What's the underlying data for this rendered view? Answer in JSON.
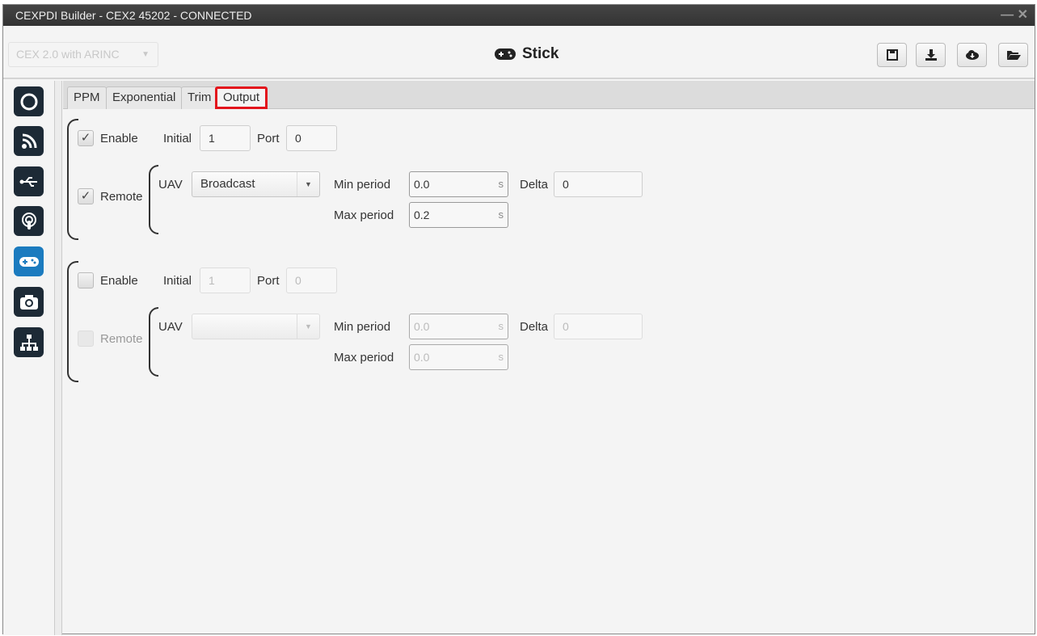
{
  "window": {
    "title": "CEXPDI Builder - CEX2 45202 - CONNECTED",
    "controls": "— ✕"
  },
  "header": {
    "device_select": "CEX 2.0 with ARINC",
    "page_title": "Stick"
  },
  "toolbar": [
    "save-icon",
    "download-icon",
    "cloud-download-icon",
    "folder-open-icon"
  ],
  "sidebar": {
    "items": [
      "power",
      "rss",
      "usb",
      "podcast",
      "gamepad",
      "camera",
      "sitemap"
    ],
    "active": "gamepad",
    "active_color": "#1b7bbf"
  },
  "tabs": {
    "items": [
      "PPM",
      "Exponential",
      "Trim",
      "Output"
    ],
    "active": "Output"
  },
  "groups": [
    {
      "enable_label": "Enable",
      "enabled": true,
      "initial_label": "Initial",
      "initial": "1",
      "port_label": "Port",
      "port": "0",
      "remote_label": "Remote",
      "remote": true,
      "uav_label": "UAV",
      "uav": "Broadcast",
      "min_period_label": "Min period",
      "min_period": "0.0",
      "max_period_label": "Max period",
      "max_period": "0.2",
      "unit": "s",
      "delta_label": "Delta",
      "delta": "0"
    },
    {
      "enable_label": "Enable",
      "enabled": false,
      "initial_label": "Initial",
      "initial": "1",
      "port_label": "Port",
      "port": "0",
      "remote_label": "Remote",
      "remote": false,
      "uav_label": "UAV",
      "uav": "",
      "min_period_label": "Min period",
      "min_period": "0.0",
      "max_period_label": "Max period",
      "max_period": "0.0",
      "unit": "s",
      "delta_label": "Delta",
      "delta": "0"
    }
  ]
}
